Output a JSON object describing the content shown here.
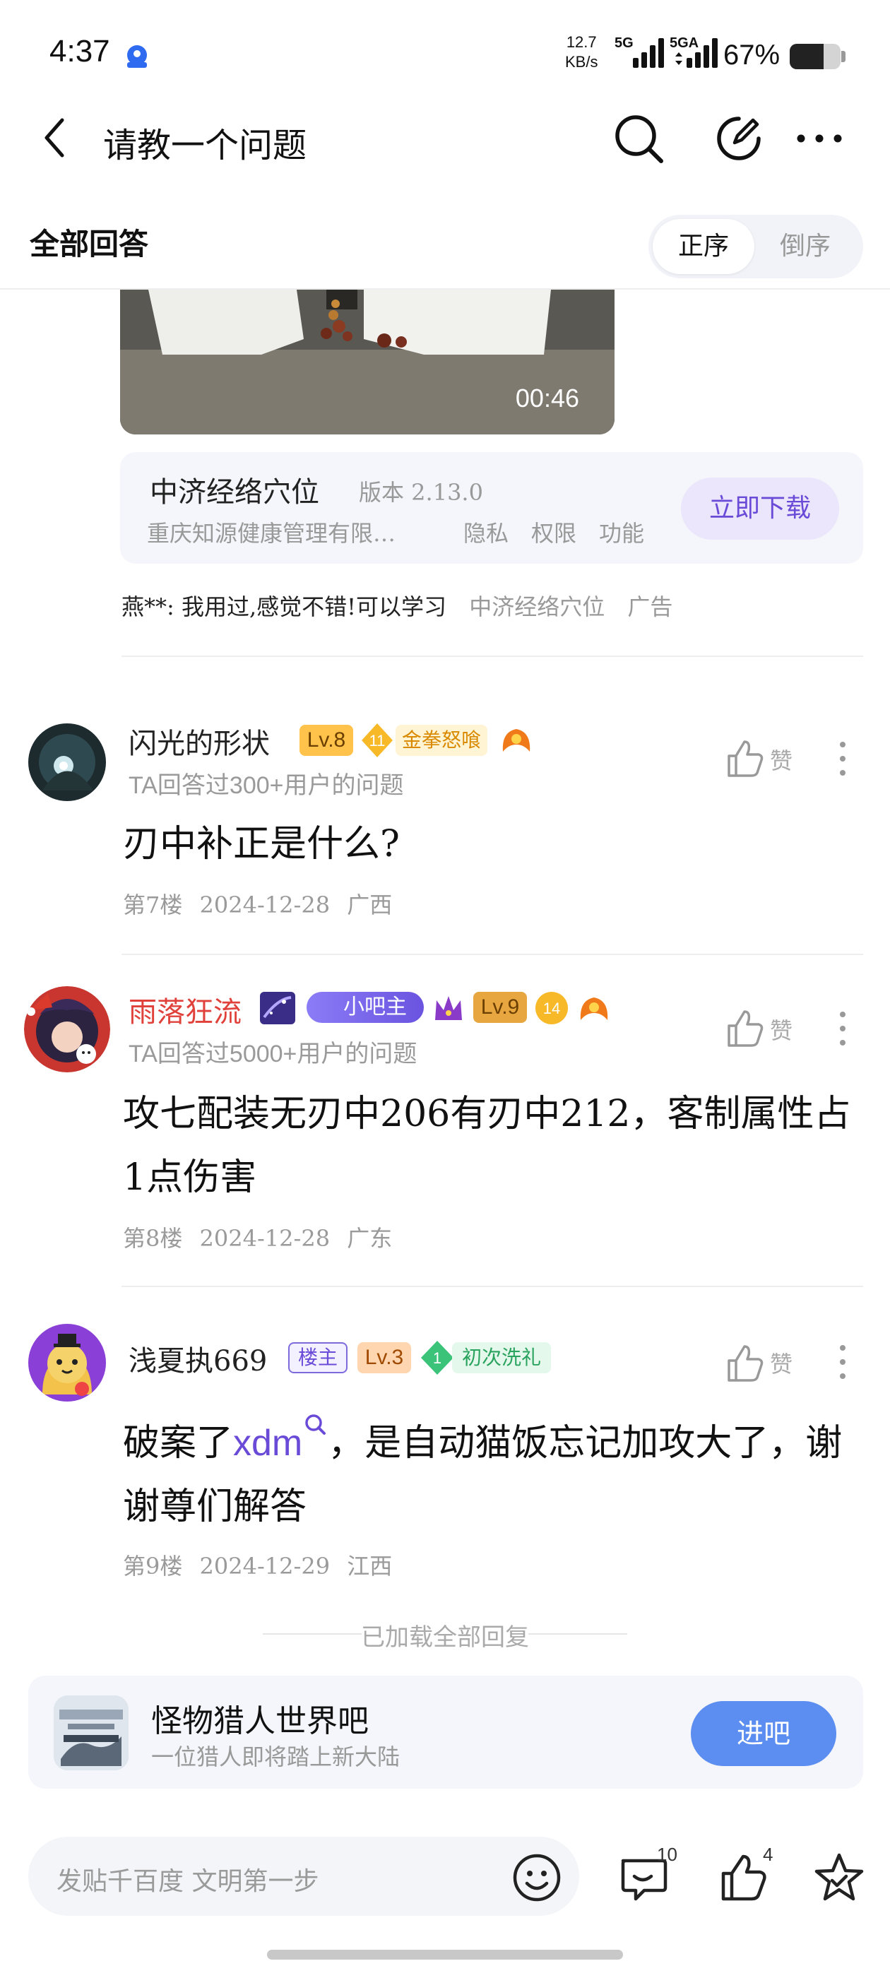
{
  "status_bar": {
    "time": "4:37",
    "net_speed_value": "12.7",
    "net_speed_unit": "KB/s",
    "sim1_label": "5G",
    "sim2_label": "5GA",
    "battery_percent_text": "67%",
    "battery_level": 0.67,
    "app_icon": "baidu-paw-icon"
  },
  "nav": {
    "title": "请教一个问题",
    "back_icon": "chevron-left-icon",
    "search_icon": "search-icon",
    "edit_icon": "edit-icon",
    "more_icon": "more-horizontal-icon"
  },
  "answers_header": {
    "title": "全部回答",
    "sort_asc": "正序",
    "sort_desc": "倒序",
    "active": "正序"
  },
  "video": {
    "duration": "00:46"
  },
  "ad_card": {
    "app_name": "中济经络穴位",
    "version": "版本 2.13.0",
    "company": "重庆知源健康管理有限…",
    "links": [
      "隐私",
      "权限",
      "功能"
    ],
    "download_label": "立即下载",
    "comment_user": "燕**:",
    "comment_text": "我用过,感觉不错!可以学习",
    "source": "中济经络穴位",
    "ad_tag": "广告"
  },
  "posts": [
    {
      "username": "闪光的形状",
      "level": "Lv.8",
      "badge_num": "11",
      "badge_text": "金拳怒喰",
      "subtitle": "TA回答过300+用户的问题",
      "content": "刃中补正是什么?",
      "floor": "第7楼",
      "date": "2024-12-28",
      "location": "广西",
      "like_label": "赞"
    },
    {
      "username": "雨落狂流",
      "role_badge": "小吧主",
      "level": "Lv.9",
      "badge_num": "14",
      "subtitle": "TA回答过5000+用户的问题",
      "content": "攻七配装无刃中206有刃中212，客制属性占1点伤害",
      "floor": "第8楼",
      "date": "2024-12-28",
      "location": "广东",
      "like_label": "赞"
    },
    {
      "username": "浅夏执669",
      "role_badge": "楼主",
      "level": "Lv.3",
      "badge_num": "1",
      "badge_text": "初次洗礼",
      "content_before": "破案了",
      "mention": "xdm",
      "content_after": "，是自动猫饭忘记加攻大了，谢谢尊们解答",
      "floor": "第9楼",
      "date": "2024-12-29",
      "location": "江西",
      "like_label": "赞"
    }
  ],
  "loaded_all": "已加载全部回复",
  "forum": {
    "name": "怪物猎人世界吧",
    "description": "一位猎人即将踏上新大陆",
    "join_label": "进吧"
  },
  "bottom_bar": {
    "reply_placeholder": "发贴千百度 文明第一步",
    "comment_count": "10",
    "like_count": "4"
  },
  "colors": {
    "accent_purple": "#6a4bd8",
    "join_blue": "#5b8ef0",
    "username_red": "#e0413a",
    "level_orange": "#ffc24a"
  }
}
